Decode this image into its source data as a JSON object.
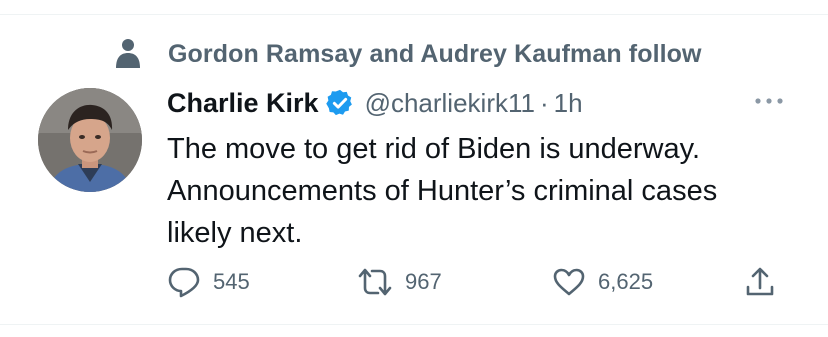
{
  "social_context": {
    "icon": "person-icon",
    "text": "Gordon Ramsay and Audrey Kaufman follow"
  },
  "tweet": {
    "author": {
      "display_name": "Charlie Kirk",
      "verified": true,
      "handle": "@charliekirk11",
      "separator": "·",
      "time": "1h"
    },
    "text": "The move to get rid of Biden is underway.\nAnnouncements of Hunter’s criminal cases\nlikely next.",
    "actions": {
      "replies": "545",
      "retweets": "967",
      "likes": "6,625"
    }
  },
  "colors": {
    "primary_text": "#0f1419",
    "secondary_text": "#536471",
    "verified_badge": "#1d9bf0",
    "divider": "#eff3f4"
  },
  "icons": [
    "person-icon",
    "verified-badge-icon",
    "more-icon",
    "reply-icon",
    "retweet-icon",
    "like-icon",
    "share-icon"
  ]
}
